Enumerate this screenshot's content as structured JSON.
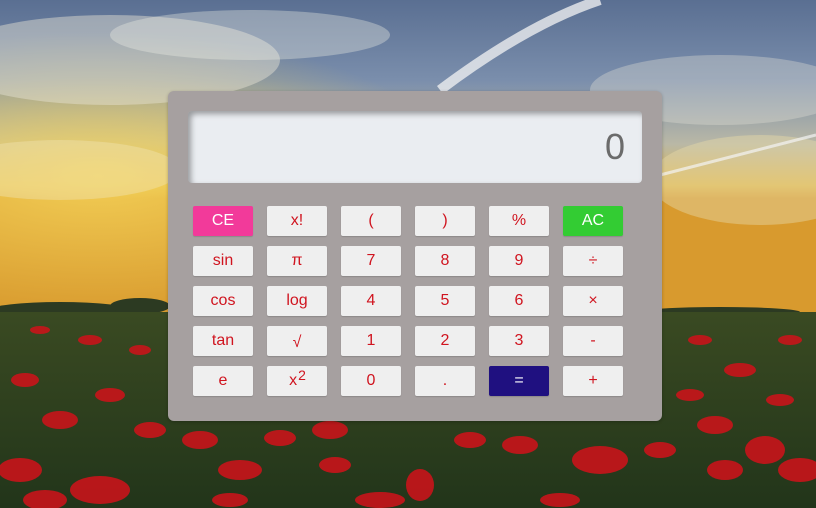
{
  "colors": {
    "panel": "#a6a0a0",
    "display_bg": "#eaedf1",
    "key_bg": "#efefef",
    "key_text": "#d0141f",
    "ce_bg": "#f23a9a",
    "ac_bg": "#33cc33",
    "equals_bg": "#1f1080"
  },
  "display": {
    "value": "0"
  },
  "keys": [
    {
      "id": "ce",
      "label": "CE",
      "icon": null
    },
    {
      "id": "factorial",
      "label": "x!",
      "icon": null
    },
    {
      "id": "open-paren",
      "label": "(",
      "icon": null
    },
    {
      "id": "close-paren",
      "label": ")",
      "icon": null
    },
    {
      "id": "percent",
      "label": "%",
      "icon": null
    },
    {
      "id": "ac",
      "label": "AC",
      "icon": null
    },
    {
      "id": "sin",
      "label": "sin",
      "icon": null
    },
    {
      "id": "pi",
      "label": "π",
      "icon": null
    },
    {
      "id": "7",
      "label": "7",
      "icon": null
    },
    {
      "id": "8",
      "label": "8",
      "icon": null
    },
    {
      "id": "9",
      "label": "9",
      "icon": null
    },
    {
      "id": "divide",
      "label": "÷",
      "icon": "divide-icon"
    },
    {
      "id": "cos",
      "label": "cos",
      "icon": null
    },
    {
      "id": "log",
      "label": "log",
      "icon": null
    },
    {
      "id": "4",
      "label": "4",
      "icon": null
    },
    {
      "id": "5",
      "label": "5",
      "icon": null
    },
    {
      "id": "6",
      "label": "6",
      "icon": null
    },
    {
      "id": "multiply",
      "label": "×",
      "icon": "multiply-icon"
    },
    {
      "id": "tan",
      "label": "tan",
      "icon": null
    },
    {
      "id": "sqrt",
      "label": "√",
      "icon": "square-root-icon"
    },
    {
      "id": "1",
      "label": "1",
      "icon": null
    },
    {
      "id": "2",
      "label": "2",
      "icon": null
    },
    {
      "id": "3",
      "label": "3",
      "icon": null
    },
    {
      "id": "minus",
      "label": "-",
      "icon": "minus-icon"
    },
    {
      "id": "e",
      "label": "e",
      "icon": null
    },
    {
      "id": "square",
      "label": "x",
      "sup": "2",
      "icon": null
    },
    {
      "id": "0",
      "label": "0",
      "icon": null
    },
    {
      "id": "decimal",
      "label": ".",
      "icon": null
    },
    {
      "id": "equals",
      "label": "=",
      "icon": "equals-icon"
    },
    {
      "id": "plus",
      "label": "+",
      "icon": "plus-icon"
    }
  ]
}
